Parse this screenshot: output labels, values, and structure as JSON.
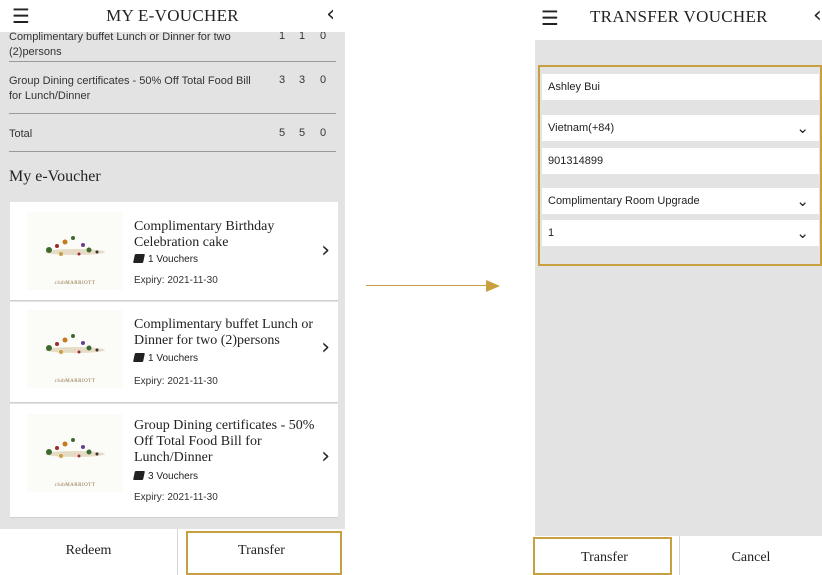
{
  "left_screen": {
    "title": "MY E-VOUCHER",
    "summary_rows": [
      {
        "name": "Complimentary buffet Lunch or Dinner for two (2)persons",
        "c1": "1",
        "c2": "1",
        "c3": "0"
      },
      {
        "name": "Group Dining certificates - 50% Off Total Food Bill for Lunch/Dinner",
        "c1": "3",
        "c2": "3",
        "c3": "0"
      },
      {
        "name": "Total",
        "c1": "5",
        "c2": "5",
        "c3": "0"
      }
    ],
    "section_title": "My e-Voucher",
    "vouchers": [
      {
        "title": "Complimentary Birthday Celebration cake",
        "count": "1 Vouchers",
        "expiry": "Expiry: 2021-11-30",
        "brand": "clubMARRIOTT"
      },
      {
        "title": "Complimentary buffet Lunch or Dinner for two (2)persons",
        "count": "1 Vouchers",
        "expiry": "Expiry: 2021-11-30",
        "brand": "clubMARRIOTT"
      },
      {
        "title": "Group Dining certificates - 50% Off Total Food Bill for Lunch/Dinner",
        "count": "3 Vouchers",
        "expiry": "Expiry: 2021-11-30",
        "brand": "clubMARRIOTT"
      }
    ],
    "redeem_label": "Redeem",
    "transfer_label": "Transfer"
  },
  "right_screen": {
    "title": "TRANSFER VOUCHER",
    "fields": {
      "name": "Ashley Bui",
      "country": "Vietnam(+84)",
      "phone": "901314899",
      "voucher": "Complimentary Room Upgrade",
      "quantity": "1"
    },
    "transfer_label": "Transfer",
    "cancel_label": "Cancel"
  },
  "icons": {
    "menu": "hamburger-menu-icon",
    "back": "chevron-left-icon",
    "forward": "chevron-right-icon",
    "dropdown": "chevron-down-icon",
    "voucher": "ticket-icon"
  },
  "colors": {
    "highlight": "#c9a03f",
    "panel_bg": "#e3e3e3",
    "card_bg": "#ffffff"
  }
}
